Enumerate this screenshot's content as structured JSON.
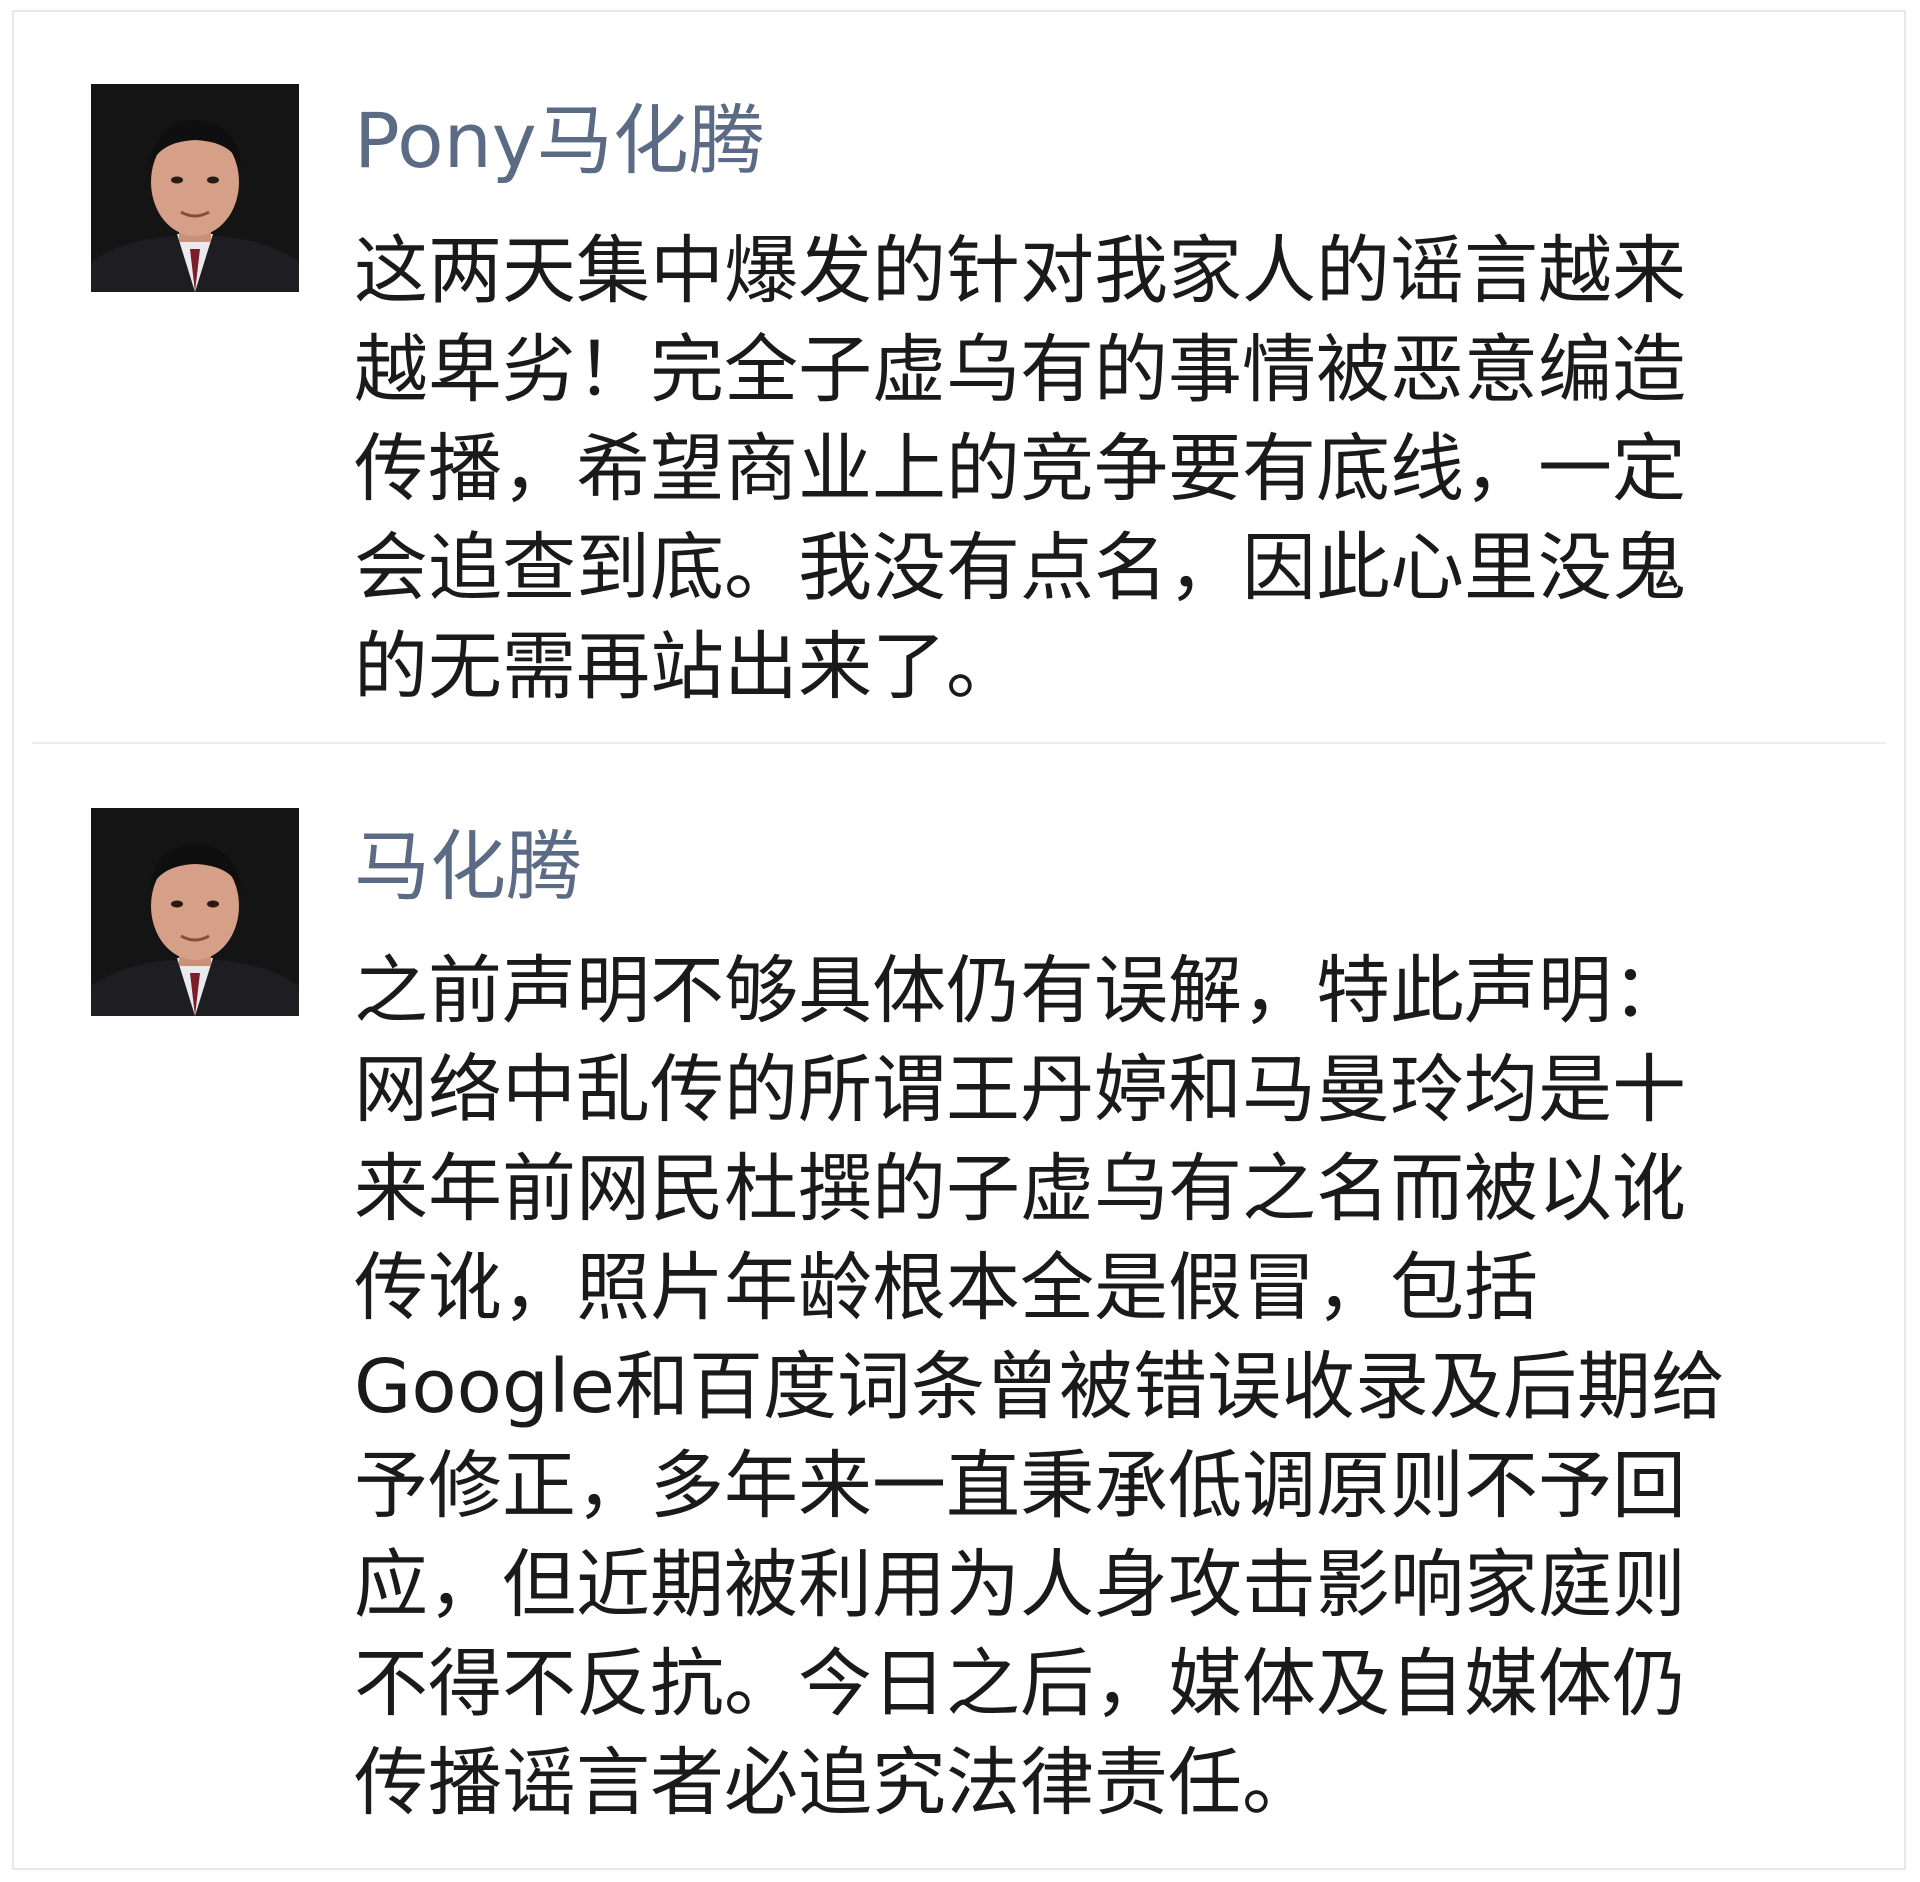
{
  "posts": [
    {
      "author": "Pony马化腾",
      "avatar_icon": "user-avatar-photo",
      "lines": [
        "这两天集中爆发的针对我家人的谣言越来",
        "越卑劣！完全子虚乌有的事情被恶意编造",
        "传播，希望商业上的竞争要有底线，一定",
        "会追查到底。我没有点名，因此心里没鬼",
        "的无需再站出来了。"
      ]
    },
    {
      "author": "马化腾",
      "avatar_icon": "user-avatar-photo",
      "lines": [
        "之前声明不够具体仍有误解，特此声明：",
        "网络中乱传的所谓王丹婷和马曼玲均是十",
        "来年前网民杜撰的子虚乌有之名而被以讹",
        "传讹，照片年龄根本全是假冒，包括",
        "Google和百度词条曾被错误收录及后期给",
        "予修正，多年来一直秉承低调原则不予回",
        "应，但近期被利用为人身攻击影响家庭则",
        "不得不反抗。今日之后，媒体及自媒体仍",
        "传播谣言者必追究法律责任。"
      ]
    }
  ],
  "colors": {
    "nickname": "#5b6a85",
    "text": "#1a1a1a",
    "background": "#ffffff",
    "divider": "#ececec"
  }
}
